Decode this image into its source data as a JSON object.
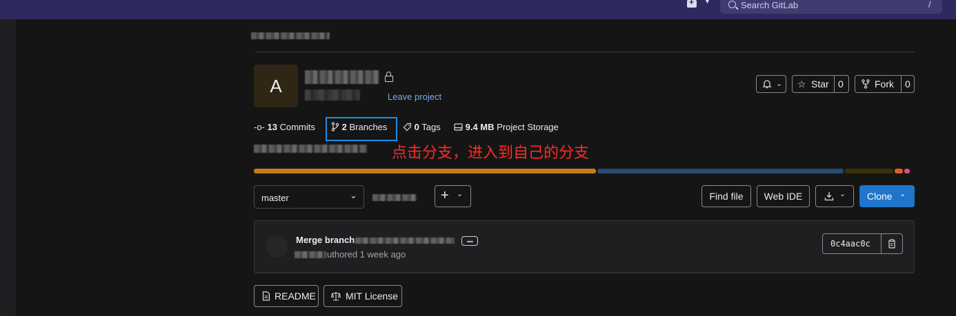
{
  "topbar": {
    "search_placeholder": "Search GitLab",
    "search_shortcut": "/"
  },
  "project": {
    "avatar_letter": "A",
    "leave_label": "Leave project",
    "star_label": "Star",
    "star_count": "0",
    "fork_label": "Fork",
    "fork_count": "0"
  },
  "stats": {
    "commits_count": "13",
    "commits_label": "Commits",
    "branches_count": "2",
    "branches_label": "Branches",
    "tags_count": "0",
    "tags_label": "Tags",
    "storage_size": "9.4 MB",
    "storage_label": "Project Storage"
  },
  "annotation": "点击分支，进入到自己的分支",
  "languages": [
    {
      "color": "#c17d1a",
      "share": 0.52
    },
    {
      "color": "#284a6d",
      "share": 0.375
    },
    {
      "color": "#3b3107",
      "share": 0.075
    },
    {
      "color": "#e05d2c",
      "share": 0.015
    },
    {
      "color": "#d64d8c",
      "share": 0.01
    }
  ],
  "toolbar": {
    "branch": "master",
    "find_file": "Find file",
    "web_ide": "Web IDE",
    "clone": "Clone"
  },
  "commit": {
    "title": "Merge branch",
    "meta": "uthored 1 week ago",
    "sha": "0c4aac0c"
  },
  "links": {
    "readme": "README",
    "license": "MIT License"
  },
  "colors": {
    "accent": "#1f75cb",
    "topbar": "#2d2a5d",
    "highlight": "#1f8ee6",
    "annotation": "#ff2a2a"
  }
}
